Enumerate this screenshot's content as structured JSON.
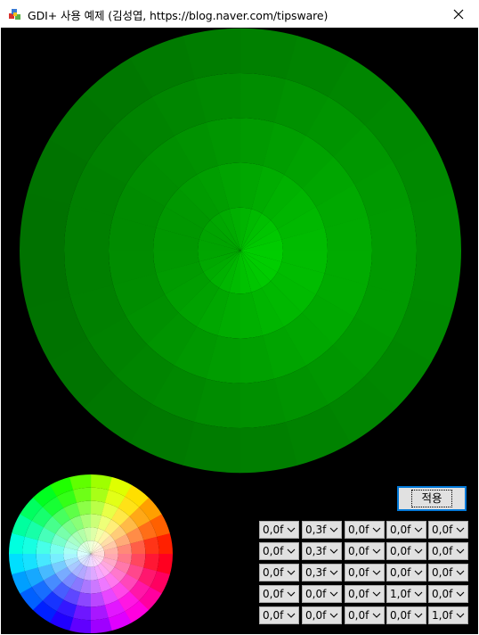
{
  "window": {
    "title": "GDI+ 사용 예제 (김성엽, https://blog.naver.com/tipsware)",
    "icon": "app-cubes-icon",
    "close_icon": "close-icon"
  },
  "canvas": {
    "background": "#000000",
    "main_wheel": {
      "base_color": "#00c800",
      "rings": 5,
      "segments_per_ring": 24,
      "description_icon": "green-color-wheel"
    },
    "mini_wheel": {
      "rings": 6,
      "segments_per_ring": 24
    }
  },
  "apply_button": {
    "label": "적용"
  },
  "matrix": {
    "rows": [
      [
        "0,0f",
        "0,3f",
        "0,0f",
        "0,0f",
        "0,0f"
      ],
      [
        "0,0f",
        "0,3f",
        "0,0f",
        "0,0f",
        "0,0f"
      ],
      [
        "0,0f",
        "0,3f",
        "0,0f",
        "0,0f",
        "0,0f"
      ],
      [
        "0,0f",
        "0,0f",
        "0,0f",
        "1,0f",
        "0,0f"
      ],
      [
        "0,0f",
        "0,0f",
        "0,0f",
        "0,0f",
        "1,0f"
      ]
    ]
  }
}
